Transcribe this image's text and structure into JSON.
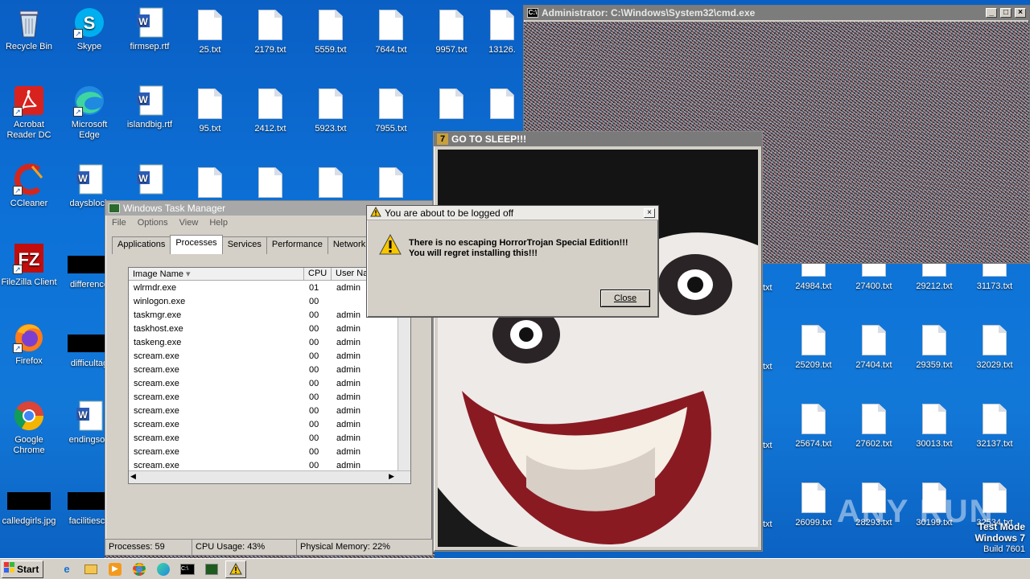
{
  "desktop": {
    "icons_col1": [
      {
        "label": "Recycle Bin",
        "icon": "recycle-bin-icon"
      },
      {
        "label": "Acrobat Reader DC",
        "icon": "acrobat-icon"
      },
      {
        "label": "CCleaner",
        "icon": "ccleaner-icon"
      },
      {
        "label": "FileZilla Client",
        "icon": "filezilla-icon"
      },
      {
        "label": "Firefox",
        "icon": "firefox-icon"
      },
      {
        "label": "Google Chrome",
        "icon": "chrome-icon"
      },
      {
        "label": "calledgirls.jpg",
        "icon": "image-file-icon"
      }
    ],
    "icons_col2": [
      {
        "label": "Skype",
        "icon": "skype-icon"
      },
      {
        "label": "Microsoft Edge",
        "icon": "edge-icon"
      },
      {
        "label": "daysblock",
        "icon": "word-doc-icon"
      },
      {
        "label": "difference",
        "icon": "image-file-icon"
      },
      {
        "label": "difficultag",
        "icon": "image-file-icon"
      },
      {
        "label": "endingsou",
        "icon": "word-doc-icon"
      },
      {
        "label": "facilitiesco",
        "icon": "image-file-icon"
      }
    ],
    "icons_row1": [
      "firmsep.rtf",
      "25.txt",
      "2179.txt",
      "5559.txt",
      "7644.txt",
      "9957.txt",
      "13126."
    ],
    "icons_row2": [
      "islandbig.rtf",
      "95.txt",
      "2412.txt",
      "5923.txt",
      "7955.txt"
    ],
    "right_grid": [
      [
        "24984.txt",
        "27400.txt",
        "29212.txt",
        "31173.txt"
      ],
      [
        "25209.txt",
        "27404.txt",
        "29359.txt",
        "32029.txt"
      ],
      [
        "25674.txt",
        "27602.txt",
        "30013.txt",
        "32137.txt"
      ],
      [
        "26099.txt",
        "28293.txt",
        "30199.txt",
        "32534.txt"
      ]
    ],
    "partial_labels": [
      "txt",
      "txt",
      "txt",
      "txt"
    ],
    "watermark": "ANY RUN",
    "testmode": {
      "line1": "Test Mode",
      "line2": "Windows 7",
      "line3": "Build 7601"
    }
  },
  "cmd": {
    "title": "Administrator: C:\\Windows\\System32\\cmd.exe"
  },
  "sleep_window": {
    "title": "GO TO SLEEP!!!"
  },
  "taskmgr": {
    "title": "Windows Task Manager",
    "menu": [
      "File",
      "Options",
      "View",
      "Help"
    ],
    "tabs": [
      "Applications",
      "Processes",
      "Services",
      "Performance",
      "Networking"
    ],
    "active_tab": "Processes",
    "columns": [
      "Image Name",
      "CPU",
      "User Na"
    ],
    "rows": [
      {
        "name": "wlrmdr.exe",
        "cpu": "01",
        "user": "admin"
      },
      {
        "name": "winlogon.exe",
        "cpu": "00",
        "user": ""
      },
      {
        "name": "taskmgr.exe",
        "cpu": "00",
        "user": "admin"
      },
      {
        "name": "taskhost.exe",
        "cpu": "00",
        "user": "admin"
      },
      {
        "name": "taskeng.exe",
        "cpu": "00",
        "user": "admin"
      },
      {
        "name": "scream.exe",
        "cpu": "00",
        "user": "admin"
      },
      {
        "name": "scream.exe",
        "cpu": "00",
        "user": "admin"
      },
      {
        "name": "scream.exe",
        "cpu": "00",
        "user": "admin"
      },
      {
        "name": "scream.exe",
        "cpu": "00",
        "user": "admin"
      },
      {
        "name": "scream.exe",
        "cpu": "00",
        "user": "admin"
      },
      {
        "name": "scream.exe",
        "cpu": "00",
        "user": "admin"
      },
      {
        "name": "scream.exe",
        "cpu": "00",
        "user": "admin"
      },
      {
        "name": "scream.exe",
        "cpu": "00",
        "user": "admin"
      },
      {
        "name": "scream.exe",
        "cpu": "00",
        "user": "admin"
      },
      {
        "name": "scream.exe",
        "cpu": "00",
        "user": "admin"
      }
    ],
    "status": {
      "processes": "Processes: 59",
      "cpu": "CPU Usage: 43%",
      "memory": "Physical Memory: 22%"
    }
  },
  "dialog": {
    "title": "You are about to be logged off",
    "line1": "There is no escaping HorrorTrojan Special Edition!!!",
    "line2": "You will regret installing this!!!",
    "close_label": "Close"
  },
  "taskbar": {
    "start_label": "Start",
    "apps": [
      "ie-icon",
      "explorer-icon",
      "media-player-icon",
      "chrome-icon",
      "edge-icon",
      "cmd-icon",
      "taskmgr-icon",
      "warning-icon"
    ]
  }
}
